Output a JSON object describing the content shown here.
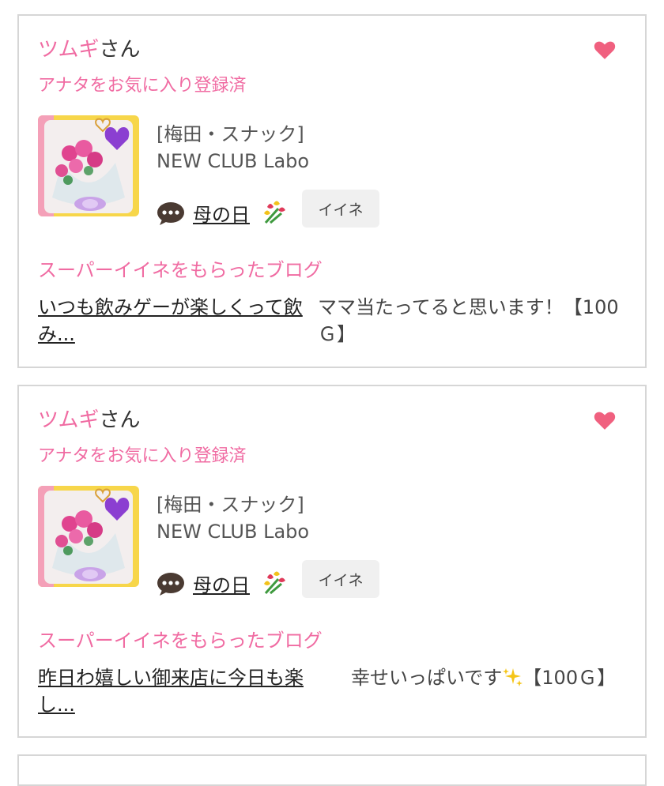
{
  "cards": [
    {
      "user_name": "ツムギ",
      "user_suffix": "さん",
      "favorite_status": "アナタをお気に入り登録済",
      "shop_category": "[梅田・スナック]",
      "shop_name": "NEW CLUB Labo",
      "blog_title": "母の日",
      "iine_label": "イイネ",
      "super_iine_label": "スーパーイイネをもらったブログ",
      "comment_link": "いつも飲みゲーが楽しくって飲み...",
      "comment_text": "ママ当たってると思います！【100Ｇ】"
    },
    {
      "user_name": "ツムギ",
      "user_suffix": "さん",
      "favorite_status": "アナタをお気に入り登録済",
      "shop_category": "[梅田・スナック]",
      "shop_name": "NEW CLUB Labo",
      "blog_title": "母の日",
      "iine_label": "イイネ",
      "super_iine_label": "スーパーイイネをもらったブログ",
      "comment_link": "昨日わ嬉しい御来店に今日も楽し...",
      "comment_text": "幸せいっぱいです",
      "comment_text_suffix": "【100Ｇ】"
    }
  ],
  "colors": {
    "accent_pink": "#f06ba2",
    "heart": "#f0607f",
    "border": "#d6d6d6",
    "iine_bg": "#f0f0f0"
  },
  "icons": {
    "heart": "heart-icon",
    "comment": "speech-bubble-icon",
    "flowers": "tulip-bouquet-emoji",
    "sparkle": "sparkles-emoji"
  }
}
